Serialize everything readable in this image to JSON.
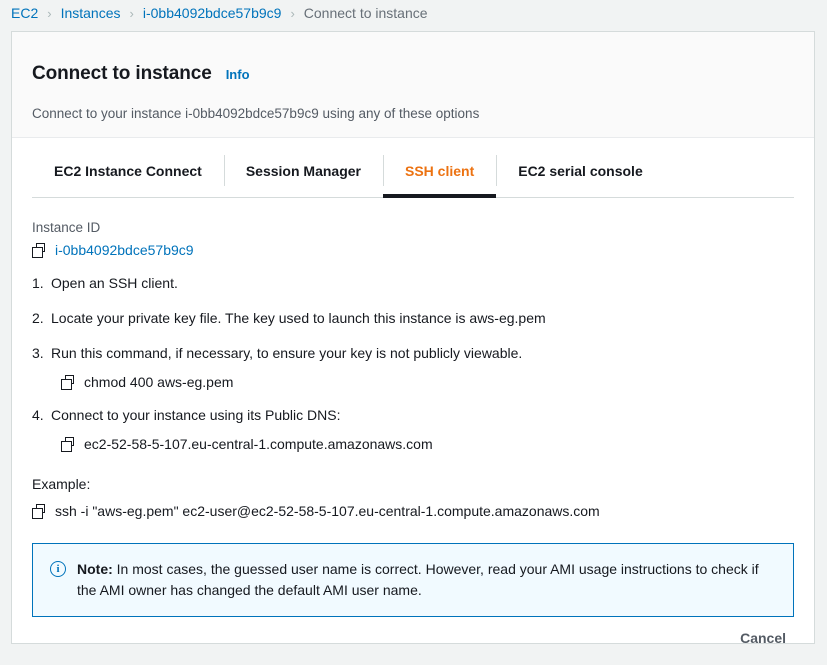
{
  "breadcrumb": {
    "items": [
      {
        "label": "EC2",
        "current": false
      },
      {
        "label": "Instances",
        "current": false
      },
      {
        "label": "i-0bb4092bdce57b9c9",
        "current": false
      },
      {
        "label": "Connect to instance",
        "current": true
      }
    ],
    "separator": "›"
  },
  "card": {
    "title": "Connect to instance",
    "info_label": "Info",
    "subtitle": "Connect to your instance i-0bb4092bdce57b9c9 using any of these options"
  },
  "tabs": [
    {
      "label": "EC2 Instance Connect",
      "active": false
    },
    {
      "label": "Session Manager",
      "active": false
    },
    {
      "label": "SSH client",
      "active": true
    },
    {
      "label": "EC2 serial console",
      "active": false
    }
  ],
  "instance": {
    "id_label": "Instance ID",
    "id_value": "i-0bb4092bdce57b9c9"
  },
  "steps": [
    {
      "num": "1.",
      "text": "Open an SSH client.",
      "command": null
    },
    {
      "num": "2.",
      "text": "Locate your private key file. The key used to launch this instance is aws-eg.pem",
      "command": null
    },
    {
      "num": "3.",
      "text": "Run this command, if necessary, to ensure your key is not publicly viewable.",
      "command": "chmod 400 aws-eg.pem"
    },
    {
      "num": "4.",
      "text": "Connect to your instance using its Public DNS:",
      "command": "ec2-52-58-5-107.eu-central-1.compute.amazonaws.com"
    }
  ],
  "example": {
    "label": "Example:",
    "command": "ssh -i \"aws-eg.pem\" ec2-user@ec2-52-58-5-107.eu-central-1.compute.amazonaws.com"
  },
  "note": {
    "prefix": "Note:",
    "body": "In most cases, the guessed user name is correct. However, read your AMI usage instructions to check if the AMI owner has changed the default AMI user name.",
    "icon_glyph": "i"
  },
  "footer": {
    "cancel_label": "Cancel"
  },
  "colors": {
    "link": "#0073bb",
    "accent_active_tab": "#ec7211",
    "page_bg": "#f1f3f3",
    "note_bg": "#f1faff",
    "note_border": "#0073bb",
    "text": "#16191f",
    "muted_text": "#545b64"
  }
}
